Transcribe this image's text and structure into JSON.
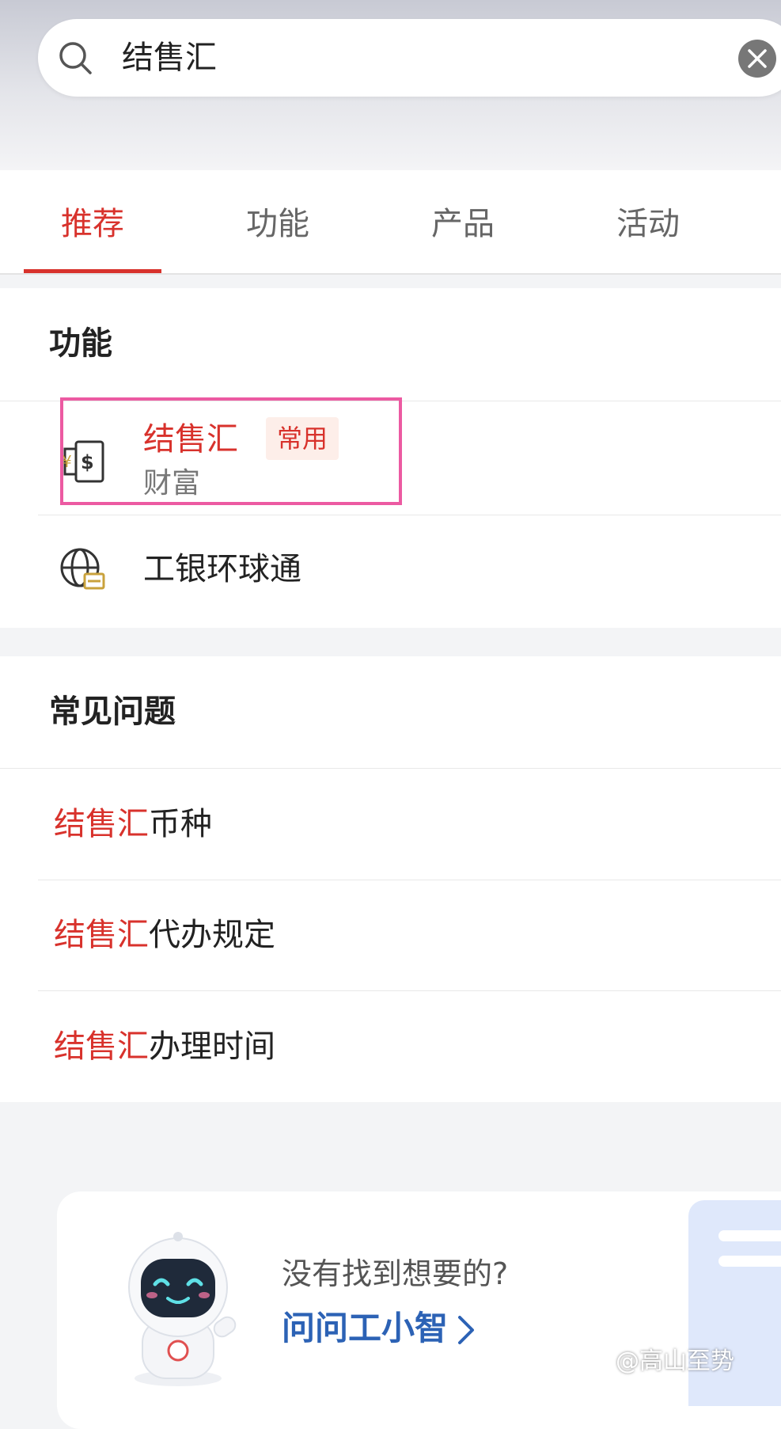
{
  "search": {
    "query": "结售汇"
  },
  "tabs": [
    {
      "label": "推荐",
      "active": true
    },
    {
      "label": "功能",
      "active": false
    },
    {
      "label": "产品",
      "active": false
    },
    {
      "label": "活动",
      "active": false
    }
  ],
  "functions": {
    "title": "功能",
    "items": [
      {
        "title": "结售汇",
        "badge": "常用",
        "subtitle": "财富",
        "icon": "currency-exchange-icon"
      },
      {
        "title": "工银环球通",
        "icon": "globe-card-icon"
      }
    ]
  },
  "faq": {
    "title": "常见问题",
    "items": [
      {
        "highlight": "结售汇",
        "rest": "币种"
      },
      {
        "highlight": "结售汇",
        "rest": "代办规定"
      },
      {
        "highlight": "结售汇",
        "rest": "办理时间"
      }
    ]
  },
  "assistant": {
    "prompt": "没有找到想要的?",
    "link": "问问工小智"
  },
  "watermark": "@高山至势",
  "colors": {
    "accent": "#d8322c",
    "link": "#2c62b5",
    "highlight_box": "#ec5aa2"
  }
}
